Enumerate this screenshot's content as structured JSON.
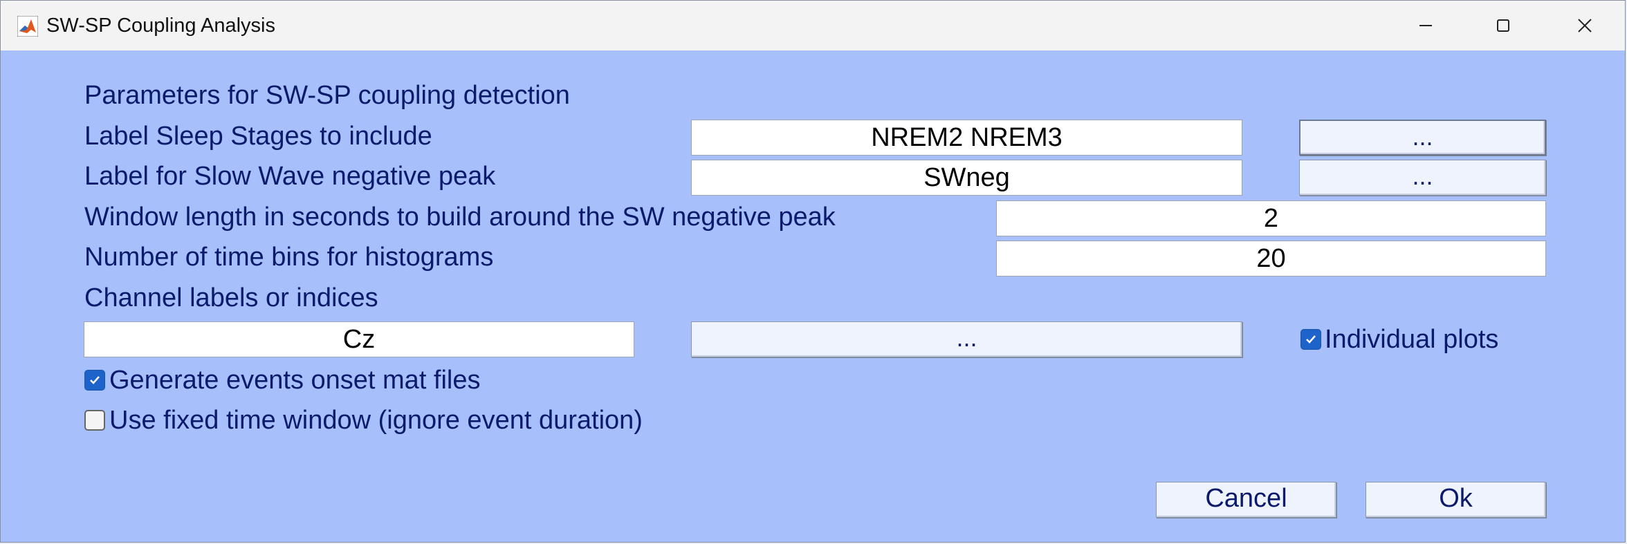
{
  "window": {
    "title": "SW-SP Coupling Analysis",
    "icon": "matlab-icon"
  },
  "controls": {
    "minimize": "minimize-icon",
    "maximize": "maximize-icon",
    "close": "close-icon"
  },
  "form": {
    "heading": "Parameters for SW-SP coupling detection",
    "sleep_stages": {
      "label": "Label Sleep Stages to include",
      "value": "NREM2 NREM3",
      "browse": "..."
    },
    "sw_peak": {
      "label": "Label for Slow Wave negative peak",
      "value": "SWneg",
      "browse": "..."
    },
    "window_length": {
      "label": "Window length in seconds to build around the SW negative peak",
      "value": "2"
    },
    "time_bins": {
      "label": "Number of time bins for histograms",
      "value": "20"
    },
    "channels": {
      "label": "Channel labels or indices",
      "value": "Cz",
      "browse": "..."
    },
    "individual_plots": {
      "label": "Individual plots",
      "checked": true
    },
    "generate_onsets": {
      "label": "Generate events onset mat files",
      "checked": true
    },
    "fixed_window": {
      "label": "Use fixed time window (ignore event duration)",
      "checked": false
    }
  },
  "buttons": {
    "cancel": "Cancel",
    "ok": "Ok"
  },
  "colors": {
    "panel_bg": "#a7bffb",
    "label_text": "#0b1a6b",
    "checkbox_on": "#1d63c9"
  }
}
